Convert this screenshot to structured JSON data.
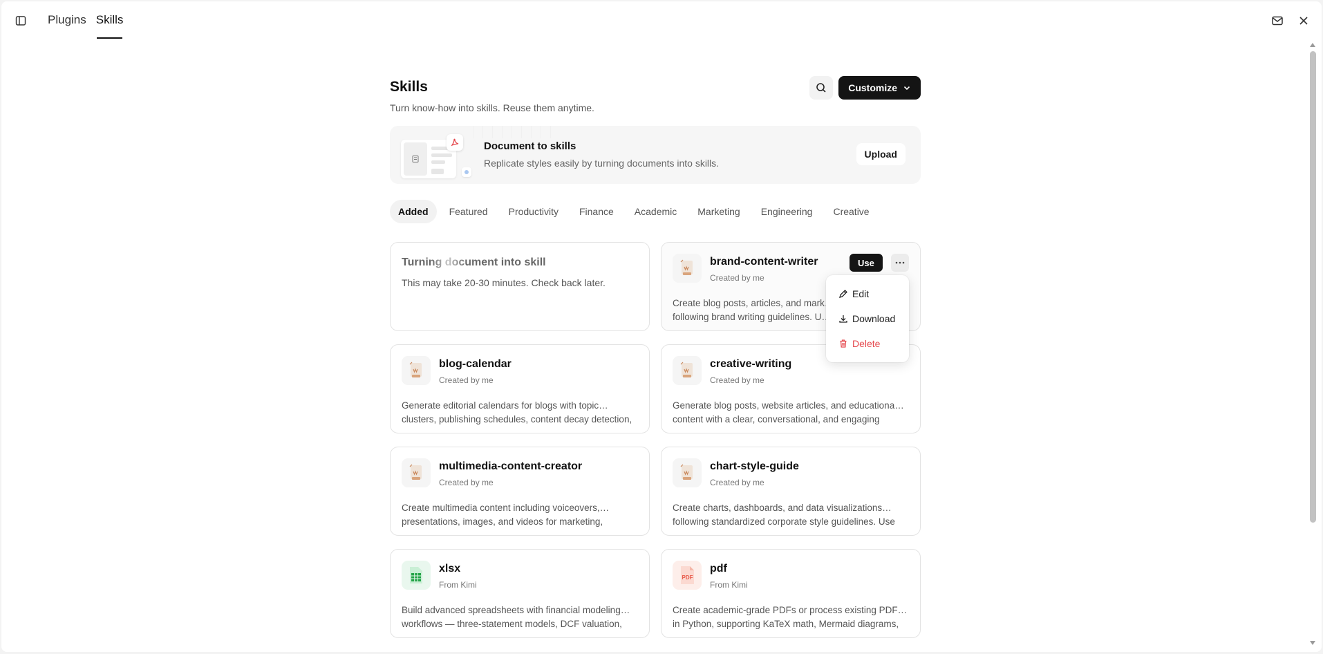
{
  "topbar": {
    "tabs": [
      {
        "label": "Plugins",
        "active": false
      },
      {
        "label": "Skills",
        "active": true
      }
    ]
  },
  "page": {
    "title": "Skills",
    "subtitle": "Turn know-how into skills. Reuse them anytime.",
    "customize_label": "Customize"
  },
  "banner": {
    "title": "Document to skills",
    "description": "Replicate styles easily by turning documents into skills.",
    "upload_label": "Upload"
  },
  "categories": [
    "Added",
    "Featured",
    "Productivity",
    "Finance",
    "Academic",
    "Marketing",
    "Engineering",
    "Creative"
  ],
  "active_category": "Added",
  "pending_card": {
    "title": "Turning document into skill",
    "description": "This may take 20-30 minutes. Check back later."
  },
  "skills": [
    {
      "name": "brand-content-writer",
      "creator": "Created by me",
      "desc_line1": "Create blog posts, articles, and mark…",
      "desc_line2": "following brand writing guidelines. U…",
      "icon": "document-pen-icon",
      "use_label": "Use"
    },
    {
      "name": "blog-calendar",
      "creator": "Created by me",
      "desc_line1": "Generate editorial calendars for blogs with topic…",
      "desc_line2": "clusters, publishing schedules, content decay detection,",
      "icon": "document-pen-icon"
    },
    {
      "name": "creative-writing",
      "creator": "Created by me",
      "desc_line1": "Generate blog posts, website articles, and educationa…",
      "desc_line2": "content with a clear, conversational, and engaging",
      "icon": "document-pen-icon"
    },
    {
      "name": "multimedia-content-creator",
      "creator": "Created by me",
      "desc_line1": "Create multimedia content including voiceovers,…",
      "desc_line2": "presentations, images, and videos for marketing,",
      "icon": "document-pen-icon"
    },
    {
      "name": "chart-style-guide",
      "creator": "Created by me",
      "desc_line1": "Create charts, dashboards, and data visualizations…",
      "desc_line2": "following standardized corporate style guidelines. Use",
      "icon": "document-pen-icon"
    },
    {
      "name": "xlsx",
      "creator": "From Kimi",
      "desc_line1": "Build advanced spreadsheets with financial modeling…",
      "desc_line2": "workflows — three-statement models, DCF valuation,",
      "icon": "spreadsheet-icon"
    },
    {
      "name": "pdf",
      "creator": "From Kimi",
      "desc_line1": "Create academic-grade PDFs or process existing PDFs…",
      "desc_line2": "in Python, supporting KaTeX math, Mermaid diagrams,",
      "icon": "pdf-file-icon",
      "icon_text": "PDF"
    }
  ],
  "context_menu": {
    "items": [
      {
        "label": "Edit",
        "icon": "pencil-icon"
      },
      {
        "label": "Download",
        "icon": "download-icon"
      },
      {
        "label": "Delete",
        "icon": "trash-icon",
        "danger": true
      }
    ]
  },
  "colors": {
    "accent_dark": "#141414",
    "danger": "#e5484d",
    "xlsx_green": "#22a447",
    "pdf_red": "#e8594a"
  }
}
